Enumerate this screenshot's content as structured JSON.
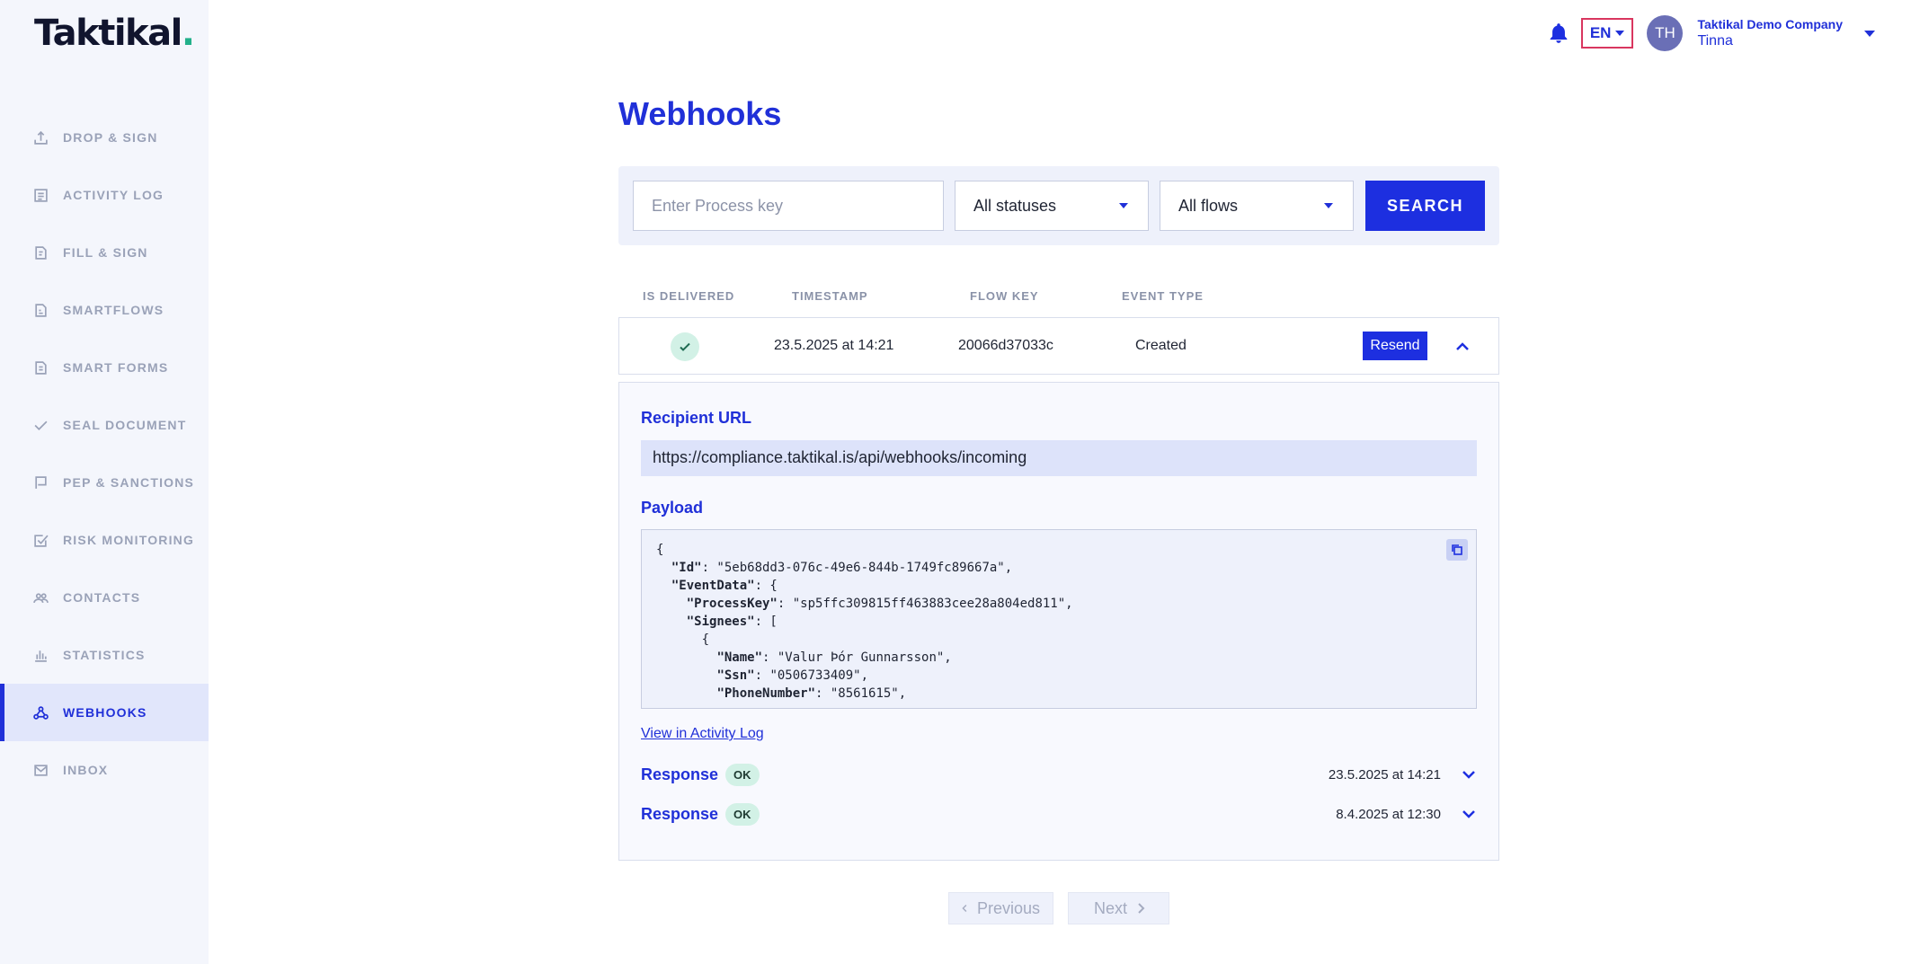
{
  "app": {
    "logo_text": "Taktikal",
    "logo_dot": "."
  },
  "sidebar": {
    "items": [
      {
        "label": "DROP & SIGN",
        "icon": "upload-icon"
      },
      {
        "label": "ACTIVITY LOG",
        "icon": "list-icon"
      },
      {
        "label": "FILL & SIGN",
        "icon": "document-icon"
      },
      {
        "label": "SMARTFLOWS",
        "icon": "flow-document-icon"
      },
      {
        "label": "SMART FORMS",
        "icon": "form-document-icon"
      },
      {
        "label": "SEAL DOCUMENT",
        "icon": "check-icon"
      },
      {
        "label": "PEP & SANCTIONS",
        "icon": "flag-icon"
      },
      {
        "label": "RISK MONITORING",
        "icon": "checkbox-icon"
      },
      {
        "label": "CONTACTS",
        "icon": "people-icon"
      },
      {
        "label": "STATISTICS",
        "icon": "bar-chart-icon"
      },
      {
        "label": "WEBHOOKS",
        "icon": "webhook-icon",
        "active": true
      },
      {
        "label": "INBOX",
        "icon": "mail-icon"
      }
    ]
  },
  "header": {
    "language": "EN",
    "avatar_initials": "TH",
    "company": "Taktikal Demo Company",
    "user": "Tinna",
    "icons": [
      "bell-icon",
      "chevron-down-icon"
    ]
  },
  "page": {
    "title": "Webhooks"
  },
  "filters": {
    "process_key_placeholder": "Enter Process key",
    "process_key_value": "",
    "status_selected": "All statuses",
    "flow_selected": "All flows",
    "search_label": "SEARCH"
  },
  "table": {
    "headers": [
      "IS DELIVERED",
      "TIMESTAMP",
      "FLOW KEY",
      "EVENT TYPE"
    ],
    "row": {
      "delivered": true,
      "timestamp": "23.5.2025 at 14:21",
      "flow_key": "20066d37033c",
      "event_type": "Created",
      "resend_label": "Resend"
    }
  },
  "detail": {
    "recipient_label": "Recipient URL",
    "recipient_url": "https://compliance.taktikal.is/api/webhooks/incoming",
    "payload_label": "Payload",
    "payload_lines": [
      {
        "indent": "",
        "key": "",
        "rest": "{"
      },
      {
        "indent": "  ",
        "key": "\"Id\"",
        "rest": ": \"5eb68dd3-076c-49e6-844b-1749fc89667a\","
      },
      {
        "indent": "  ",
        "key": "\"EventData\"",
        "rest": ": {"
      },
      {
        "indent": "    ",
        "key": "\"ProcessKey\"",
        "rest": ": \"sp5ffc309815ff463883cee28a804ed811\","
      },
      {
        "indent": "    ",
        "key": "\"Signees\"",
        "rest": ": ["
      },
      {
        "indent": "      ",
        "key": "",
        "rest": "{"
      },
      {
        "indent": "        ",
        "key": "\"Name\"",
        "rest": ": \"Valur Þór Gunnarsson\","
      },
      {
        "indent": "        ",
        "key": "\"Ssn\"",
        "rest": ": \"0506733409\","
      },
      {
        "indent": "        ",
        "key": "\"PhoneNumber\"",
        "rest": ": \"8561615\","
      }
    ],
    "view_link": "View in Activity Log",
    "responses": [
      {
        "label": "Response",
        "status": "OK",
        "time": "23.5.2025 at 14:21"
      },
      {
        "label": "Response",
        "status": "OK",
        "time": "8.4.2025 at 12:30"
      }
    ]
  },
  "pagination": {
    "previous": "Previous",
    "next": "Next"
  },
  "colors": {
    "brand_blue": "#2030d8",
    "button_blue": "#1d2fe0",
    "sidebar_bg": "#f4f6fc",
    "success_bg": "#d2f1e6",
    "lang_border": "#d9365f",
    "logo_dot": "#22b08a"
  }
}
